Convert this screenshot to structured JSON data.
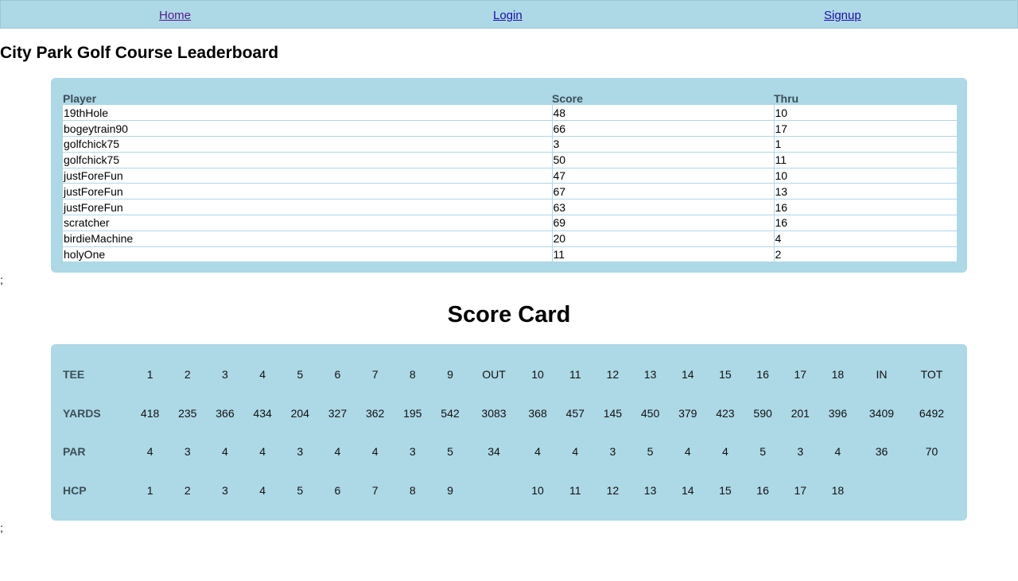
{
  "nav": {
    "home": "Home",
    "login": "Login",
    "signup": "Signup"
  },
  "leaderboard": {
    "title": "City Park Golf Course Leaderboard",
    "headers": [
      "Player",
      "Score",
      "Thru"
    ],
    "rows": [
      [
        "19thHole",
        "48",
        "10"
      ],
      [
        "bogeytrain90",
        "66",
        "17"
      ],
      [
        "golfchick75",
        "3",
        "1"
      ],
      [
        "golfchick75",
        "50",
        "11"
      ],
      [
        "justForeFun",
        "47",
        "10"
      ],
      [
        "justForeFun",
        "67",
        "13"
      ],
      [
        "justForeFun",
        "63",
        "16"
      ],
      [
        "scratcher",
        "69",
        "16"
      ],
      [
        "birdieMachine",
        "20",
        "4"
      ],
      [
        "holyOne",
        "11",
        "2"
      ]
    ],
    "trailing_text": ";"
  },
  "scorecard": {
    "title": "Score Card",
    "rows": [
      {
        "label": "TEE",
        "cells": [
          "1",
          "2",
          "3",
          "4",
          "5",
          "6",
          "7",
          "8",
          "9",
          "OUT",
          "10",
          "11",
          "12",
          "13",
          "14",
          "15",
          "16",
          "17",
          "18",
          "IN",
          "TOT"
        ]
      },
      {
        "label": "YARDS",
        "cells": [
          "418",
          "235",
          "366",
          "434",
          "204",
          "327",
          "362",
          "195",
          "542",
          "3083",
          "368",
          "457",
          "145",
          "450",
          "379",
          "423",
          "590",
          "201",
          "396",
          "3409",
          "6492"
        ]
      },
      {
        "label": "PAR",
        "cells": [
          "4",
          "3",
          "4",
          "4",
          "3",
          "4",
          "4",
          "3",
          "5",
          "34",
          "4",
          "4",
          "3",
          "5",
          "4",
          "4",
          "5",
          "3",
          "4",
          "36",
          "70"
        ]
      },
      {
        "label": "HCP",
        "cells": [
          "1",
          "2",
          "3",
          "4",
          "5",
          "6",
          "7",
          "8",
          "9",
          "",
          "10",
          "11",
          "12",
          "13",
          "14",
          "15",
          "16",
          "17",
          "18",
          "",
          ""
        ]
      }
    ],
    "trailing_text": ";"
  }
}
